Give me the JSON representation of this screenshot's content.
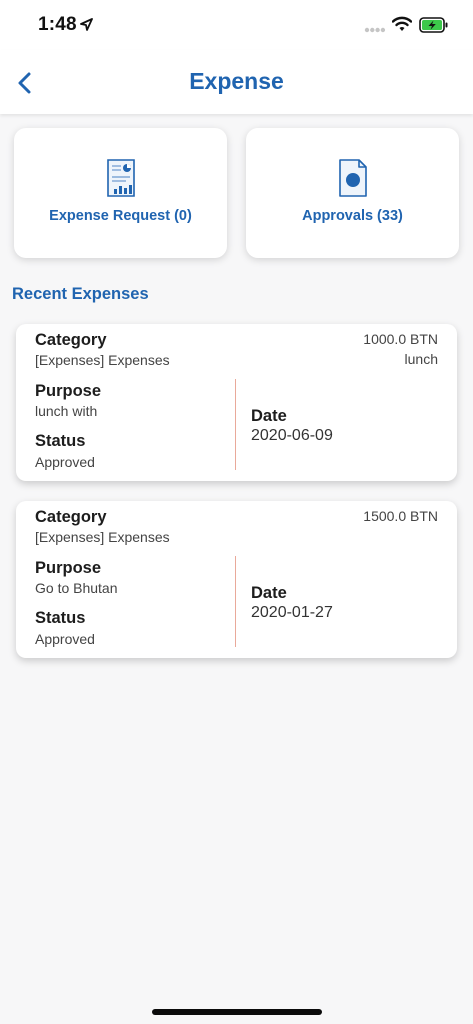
{
  "status_bar": {
    "time": "1:48"
  },
  "header": {
    "title": "Expense"
  },
  "tiles": [
    {
      "label": "Expense Request (0)",
      "icon": "report-document-icon"
    },
    {
      "label": "Approvals (33)",
      "icon": "approval-document-icon"
    }
  ],
  "section_title": "Recent Expenses",
  "expenses": [
    {
      "category_label": "Category",
      "category": "[Expenses] Expenses",
      "amount": "1000.0 BTN",
      "note": "lunch",
      "purpose_label": "Purpose",
      "purpose": "lunch with",
      "status_label": "Status",
      "status": "Approved",
      "date_label": "Date",
      "date": "2020-06-09"
    },
    {
      "category_label": "Category",
      "category": "[Expenses] Expenses",
      "amount": "1500.0 BTN",
      "note": "",
      "purpose_label": "Purpose",
      "purpose": "Go to Bhutan",
      "status_label": "Status",
      "status": "Approved",
      "date_label": "Date",
      "date": "2020-01-27"
    }
  ],
  "colors": {
    "accent": "#2064b0",
    "divider": "#e9a99a",
    "battery": "#3cc84a"
  }
}
